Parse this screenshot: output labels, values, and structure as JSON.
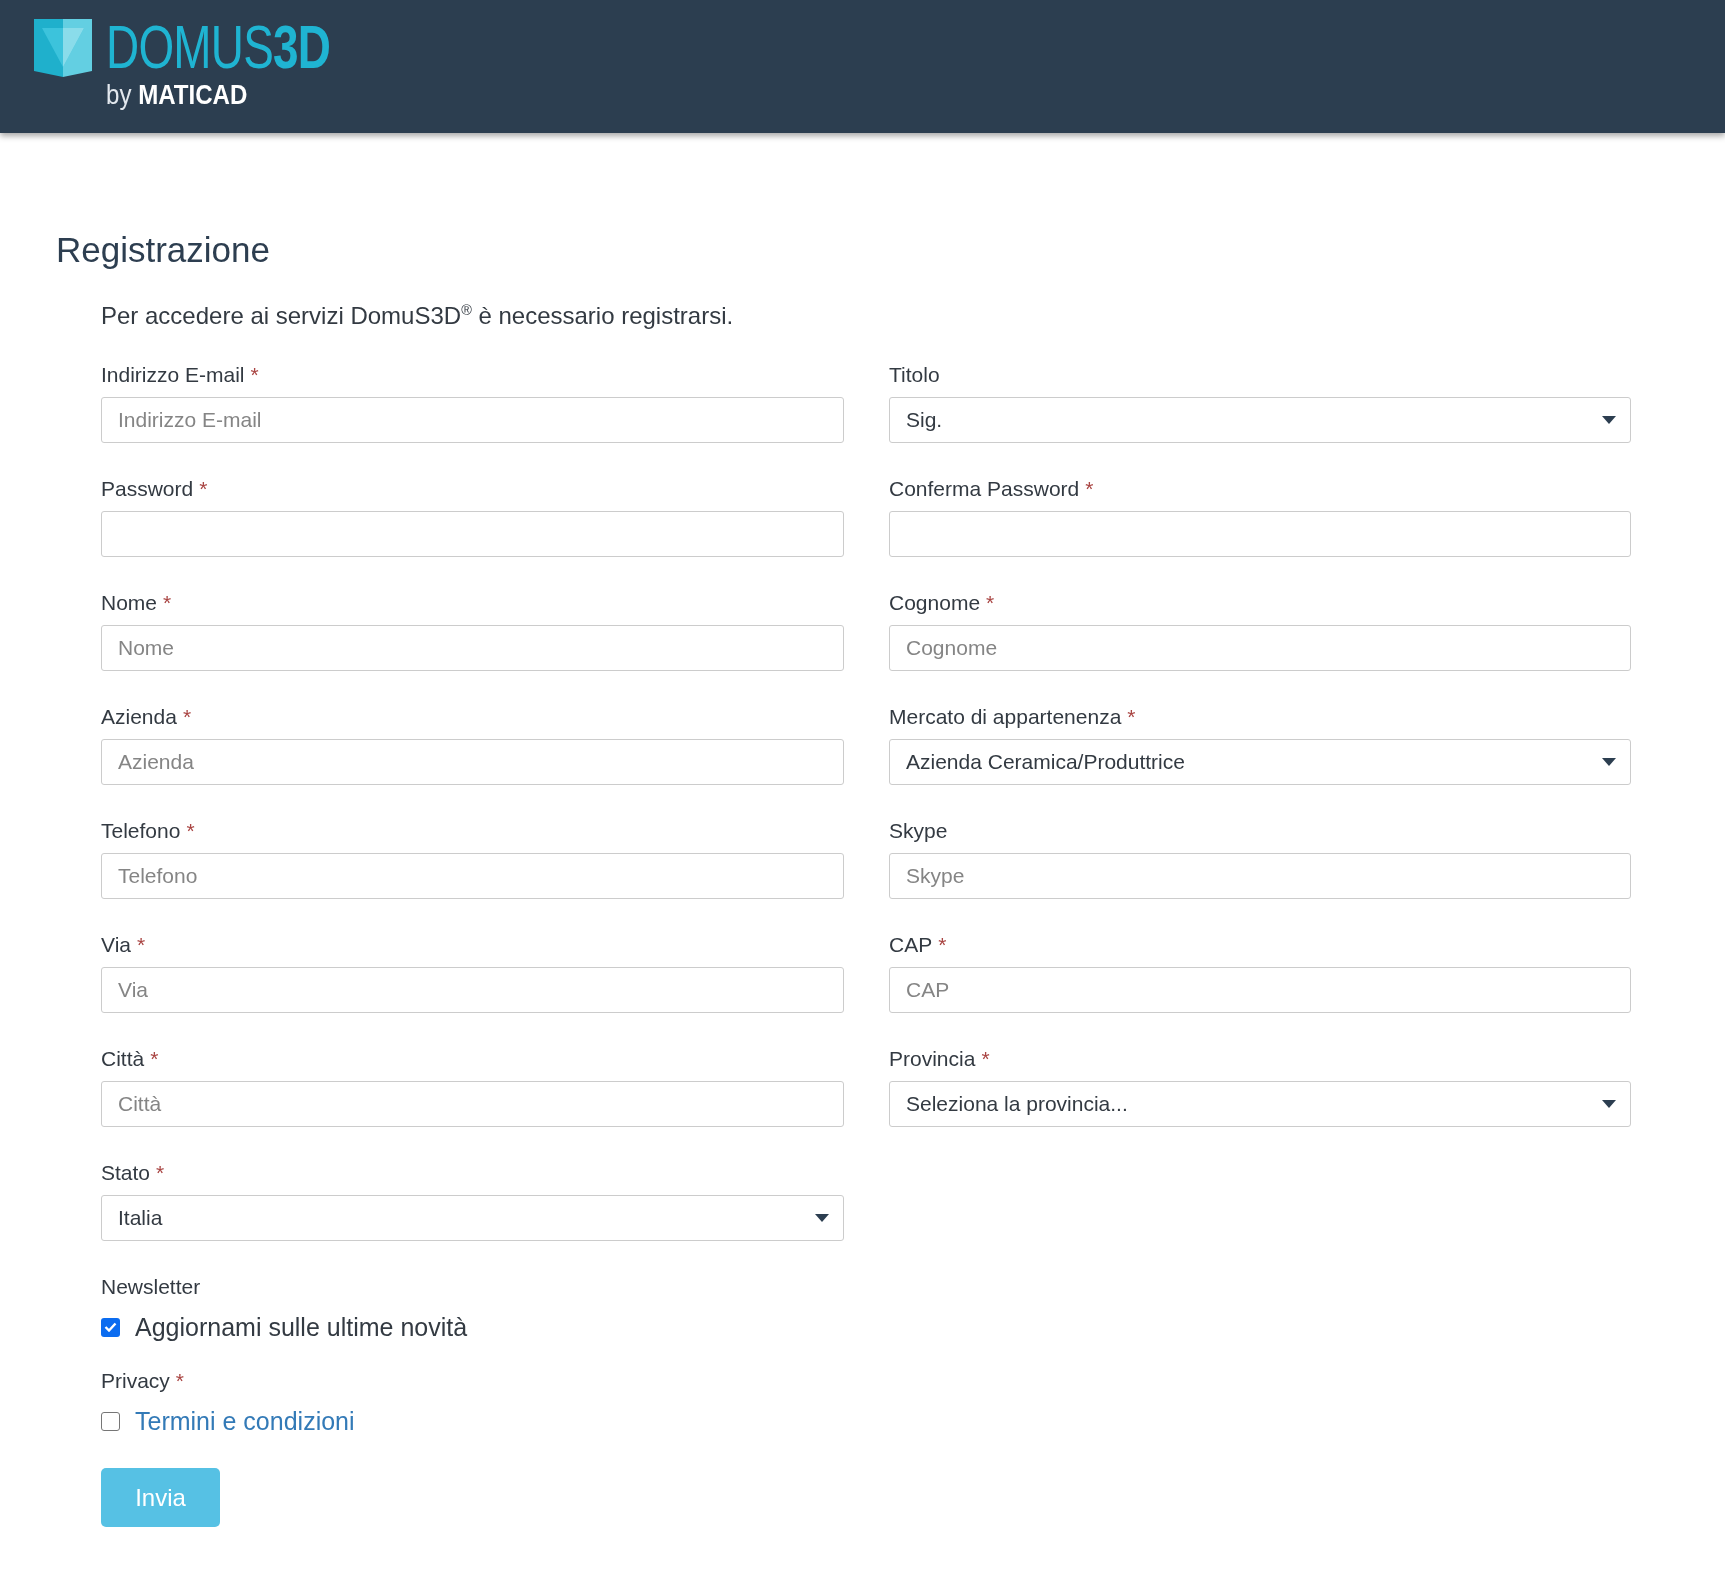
{
  "header": {
    "logo": {
      "wordmark": "DOMUS**3D**",
      "tagline": "by **MATICAD**"
    }
  },
  "title": "Registrazione",
  "intro": "Per accedere ai servizi DomuS3D$^{®}$ è necessario registrarsi.",
  "form": {
    "fields": [
      {
        "kind": "text",
        "label": "Indirizzo E-mail",
        "required_mark": "*",
        "placeholder": "Indirizzo E-mail"
      },
      {
        "kind": "select",
        "label": "Titolo",
        "value": "Sig."
      },
      {
        "kind": "password",
        "label": "Password",
        "required_mark": "*"
      },
      {
        "kind": "password",
        "label": "Conferma Password",
        "required_mark": "*"
      },
      {
        "kind": "text",
        "label": "Nome",
        "required_mark": "*",
        "placeholder": "Nome"
      },
      {
        "kind": "text",
        "label": "Cognome",
        "required_mark": "*",
        "placeholder": "Cognome"
      },
      {
        "kind": "text",
        "label": "Azienda",
        "required_mark": "*",
        "placeholder": "Azienda"
      },
      {
        "kind": "select",
        "label": "Mercato di appartenenza",
        "required_mark": "*",
        "value": "Azienda Ceramica/Produttrice"
      },
      {
        "kind": "text",
        "label": "Telefono",
        "required_mark": "*",
        "placeholder": "Telefono"
      },
      {
        "kind": "text",
        "label": "Skype",
        "placeholder": "Skype"
      },
      {
        "kind": "text",
        "label": "Via",
        "required_mark": "*",
        "placeholder": "Via"
      },
      {
        "kind": "text",
        "label": "CAP",
        "required_mark": "*",
        "placeholder": "CAP"
      },
      {
        "kind": "text",
        "label": "Città",
        "required_mark": "*",
        "placeholder": "Città"
      },
      {
        "kind": "select",
        "label": "Provincia",
        "required_mark": "*",
        "value": "Seleziona la provincia..."
      },
      {
        "kind": "select",
        "label": "Stato",
        "required_mark": "*",
        "value": "Italia"
      }
    ],
    "options": [
      {
        "label": "Newsletter",
        "choice": {
          "kind": "text",
          "text": "Aggiornami sulle ultime novità",
          "checked": true
        }
      },
      {
        "label": "Privacy",
        "required_mark": "*",
        "choice": {
          "kind": "link",
          "text": "Termini e condizioni",
          "checked": false
        }
      }
    ],
    "submit": "Invia"
  }
}
